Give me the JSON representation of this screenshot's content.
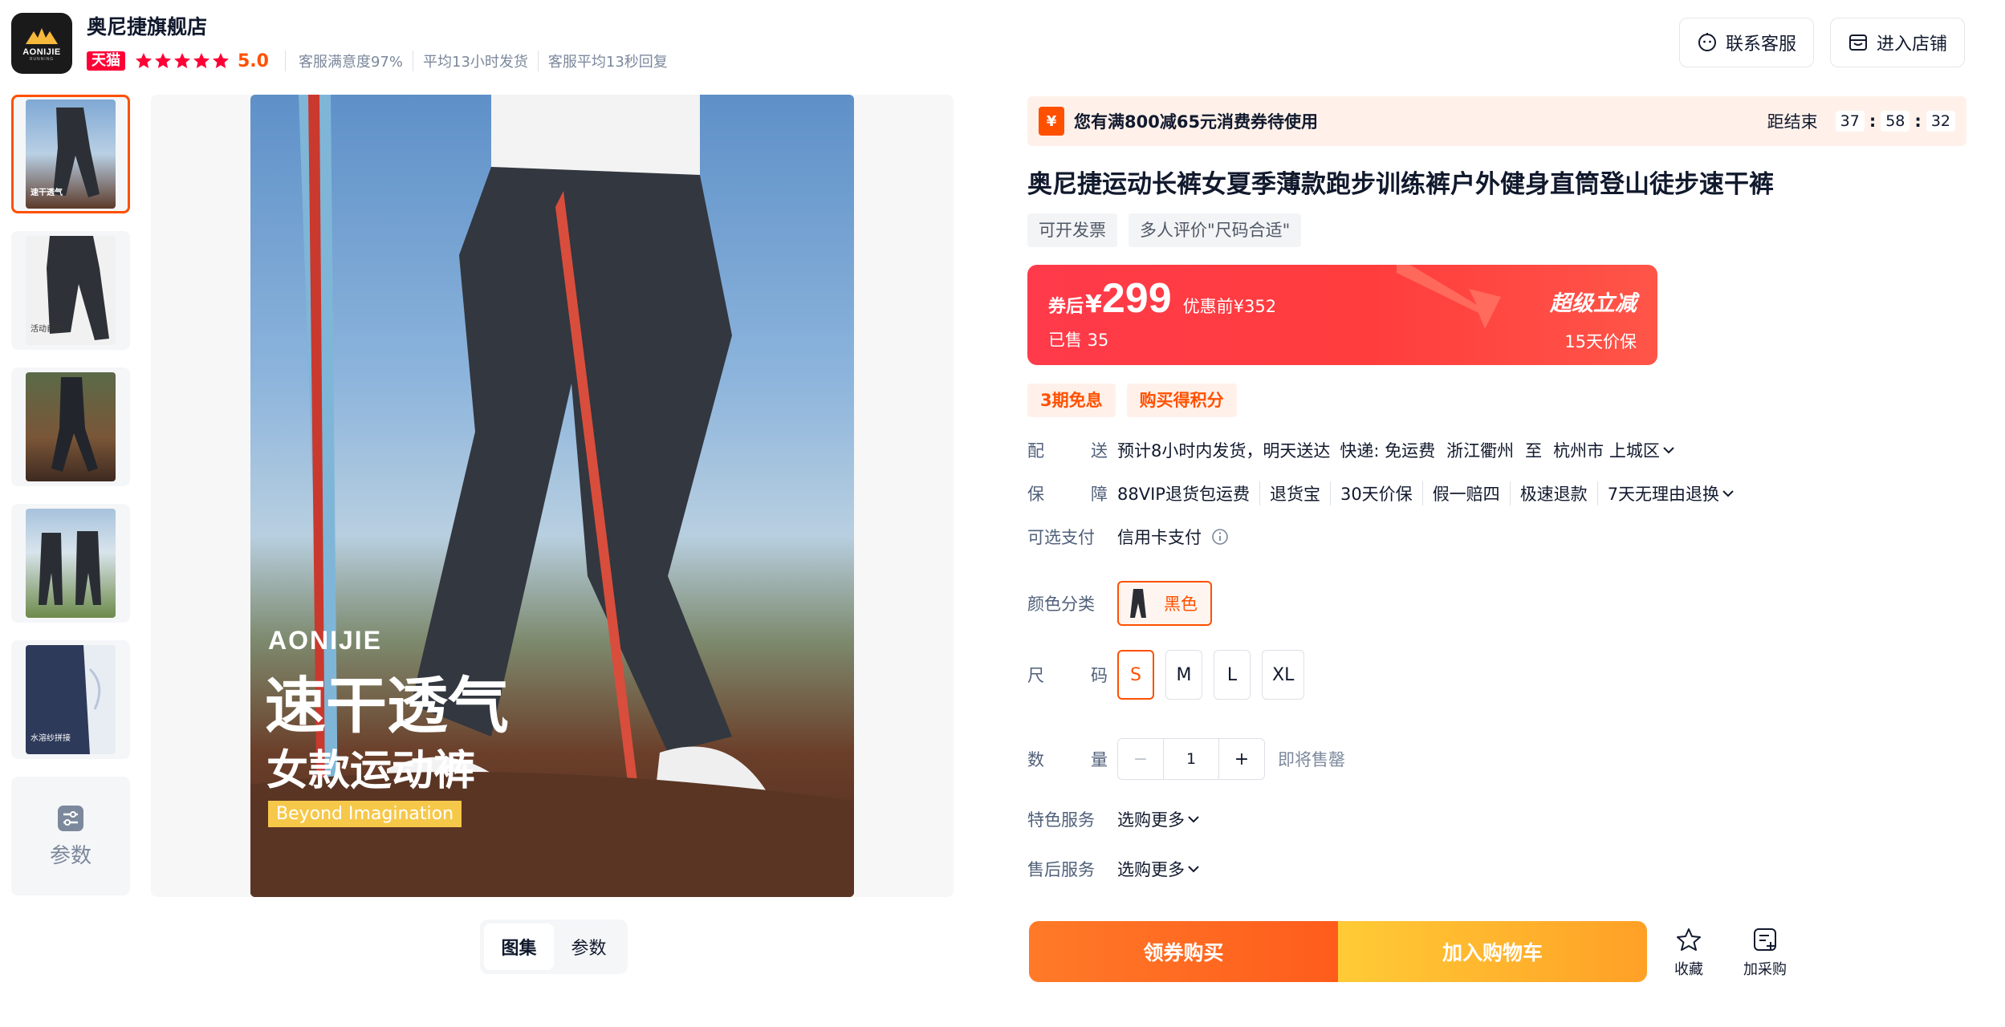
{
  "shop": {
    "name": "奥尼捷旗舰店",
    "logo_text": "AONIJIE",
    "logo_sub": "RUNNING",
    "tmall_badge": "天猫",
    "rating": "5.0",
    "meta": [
      "客服满意度97%",
      "平均13小时发货",
      "客服平均13秒回复"
    ],
    "contact_label": "联系客服",
    "enter_shop_label": "进入店铺"
  },
  "thumbnails": [
    {
      "caption": "速干透气",
      "active": true
    },
    {
      "caption": "活动自如",
      "active": false
    },
    {
      "caption": "",
      "active": false
    },
    {
      "caption": "",
      "active": false
    },
    {
      "caption": "水溶纱拼接",
      "active": false
    }
  ],
  "params_thumb_label": "参数",
  "main_image": {
    "brand": "AONIJIE",
    "slogan_main": "速干透气",
    "slogan_sub": "女款运动裤",
    "slogan_tag": "Beyond  Imagination"
  },
  "gallery_tabs": [
    {
      "label": "图集",
      "active": true
    },
    {
      "label": "参数",
      "active": false
    }
  ],
  "coupon": {
    "icon": "¥",
    "text": "您有满800减65元消费券待使用",
    "countdown_label": "距结束",
    "hours": "37",
    "minutes": "58",
    "seconds": "32"
  },
  "product": {
    "title": "奥尼捷运动长裤女夏季薄款跑步训练裤户外健身直筒登山徒步速干裤",
    "tags": [
      "可开发票",
      "多人评价\"尺码合适\""
    ]
  },
  "price": {
    "after_label": "券后",
    "currency": "¥",
    "value": "299",
    "before": "优惠前¥352",
    "sold": "已售 35",
    "super_label": "超级立减",
    "guarantee": "15天价保"
  },
  "promos": [
    "3期免息",
    "购买得积分"
  ],
  "delivery": {
    "label_a": "配",
    "label_b": "送",
    "text": "预计8小时内发货，明天送达",
    "express": "快递: 免运费",
    "from": "浙江衢州",
    "to_word": "至",
    "to": "杭州市 上城区"
  },
  "guarantee": {
    "label_a": "保",
    "label_b": "障",
    "items": [
      "88VIP退货包运费",
      "退货宝",
      "30天价保",
      "假一赔四",
      "极速退款",
      "7天无理由退换"
    ]
  },
  "payment": {
    "label": "可选支付",
    "value": "信用卡支付"
  },
  "color": {
    "label": "颜色分类",
    "selected": "黑色"
  },
  "size": {
    "label_a": "尺",
    "label_b": "码",
    "options": [
      "S",
      "M",
      "L",
      "XL"
    ],
    "selected": "S"
  },
  "quantity": {
    "label_a": "数",
    "label_b": "量",
    "minus": "−",
    "value": "1",
    "plus": "+",
    "status": "即将售罄"
  },
  "special_service": {
    "label": "特色服务",
    "value": "选购更多"
  },
  "after_sale": {
    "label": "售后服务",
    "value": "选购更多"
  },
  "actions": {
    "buy_label": "领券购买",
    "cart_label": "加入购物车",
    "favorite_label": "收藏",
    "purchase_list_label": "加采购"
  },
  "colors": {
    "accent": "#ff5000",
    "price_red": "#ff3a4a",
    "tmall": "#ff0036"
  }
}
